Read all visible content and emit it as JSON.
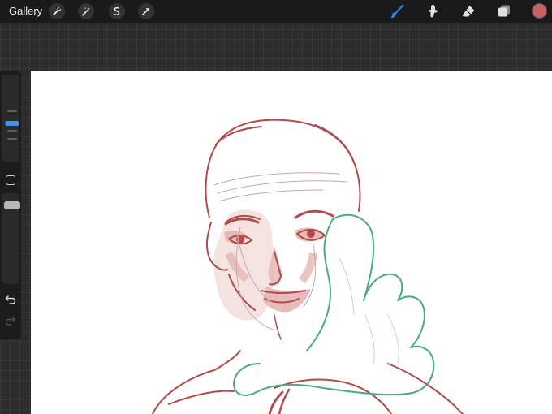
{
  "topbar": {
    "gallery_label": "Gallery",
    "left_tools": [
      {
        "icon": "wrench-icon"
      },
      {
        "icon": "magic-wand-icon"
      },
      {
        "icon": "selection-icon"
      },
      {
        "icon": "transform-arrow-icon"
      }
    ],
    "right_tools": [
      {
        "icon": "brush-icon",
        "active": true
      },
      {
        "icon": "smudge-icon"
      },
      {
        "icon": "eraser-icon"
      },
      {
        "icon": "layers-icon"
      }
    ],
    "current_color": "#c86363"
  },
  "colors": {
    "active_tool": "#2f7cf6",
    "toolbar_bg": "#1a1a1a",
    "canvas_bg": "#ffffff",
    "sketch_red": "#b34b4b",
    "sketch_green": "#4aab7d",
    "skin_fill": "#e3b5b2"
  },
  "sidebar": {
    "brush_size_level": 0.23,
    "opacity_level": 0.85,
    "undo_icon": "undo-icon",
    "redo_icon": "redo-icon"
  }
}
